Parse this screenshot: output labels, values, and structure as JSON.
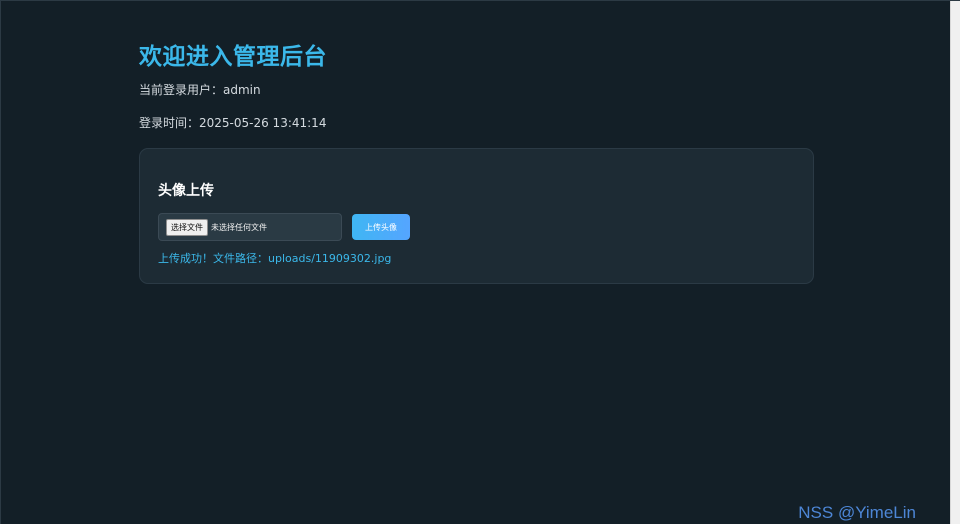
{
  "page": {
    "title": "欢迎进入管理后台",
    "current_user_line": "当前登录用户：admin",
    "login_time_line": "登录时间：2025-05-26 13:41:14"
  },
  "upload_card": {
    "title": "头像上传",
    "choose_file_label": "选择文件",
    "no_file_text": "未选择任何文件",
    "upload_button_label": "上传头像",
    "result_message": "上传成功！文件路径：uploads/11909302.jpg"
  },
  "watermark": "NSS @YimeLin",
  "colors": {
    "background": "#131f27",
    "card": "#1d2b34",
    "accent": "#3bb8ea",
    "button_gradient_start": "#3fb6f3",
    "button_gradient_end": "#55a5ff"
  }
}
